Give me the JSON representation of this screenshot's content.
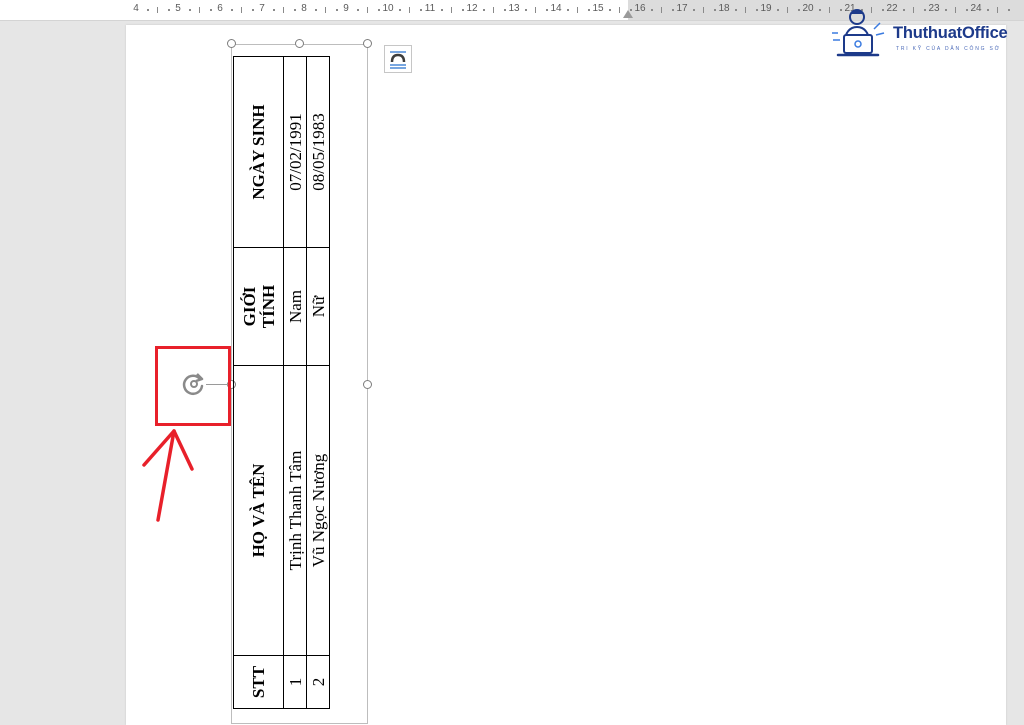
{
  "ruler": {
    "numbers": [
      "4",
      "5",
      "6",
      "7",
      "8",
      "9",
      "10",
      "11",
      "12",
      "13",
      "14",
      "15",
      "16",
      "17",
      "18",
      "19",
      "20",
      "21",
      "22",
      "23",
      "24"
    ]
  },
  "logo": {
    "brand": "ThuthuatOffice",
    "tagline": "TRI KỸ CỦA DÂN CÔNG SỞ"
  },
  "table": {
    "headers": {
      "stt": "STT",
      "name": "HỌ VÀ TÊN",
      "gender_line1": "GIỚI",
      "gender_line2": "TÍNH",
      "dob": "NGÀY SINH"
    },
    "rows": [
      {
        "stt": "1",
        "name": "Trịnh Thanh Tâm",
        "gender": "Nam",
        "dob": "07/02/1991"
      },
      {
        "stt": "2",
        "name": "Vũ Ngọc Nương",
        "gender": "Nữ",
        "dob": "08/05/1983"
      }
    ]
  },
  "icons": {
    "rotate": "rotate-handle-icon",
    "layout": "layout-options-icon",
    "logo": "person-laptop-icon"
  },
  "colors": {
    "highlight": "#e8202a",
    "logo_blue": "#1d3a8a",
    "workspace": "#e6e6e6"
  }
}
